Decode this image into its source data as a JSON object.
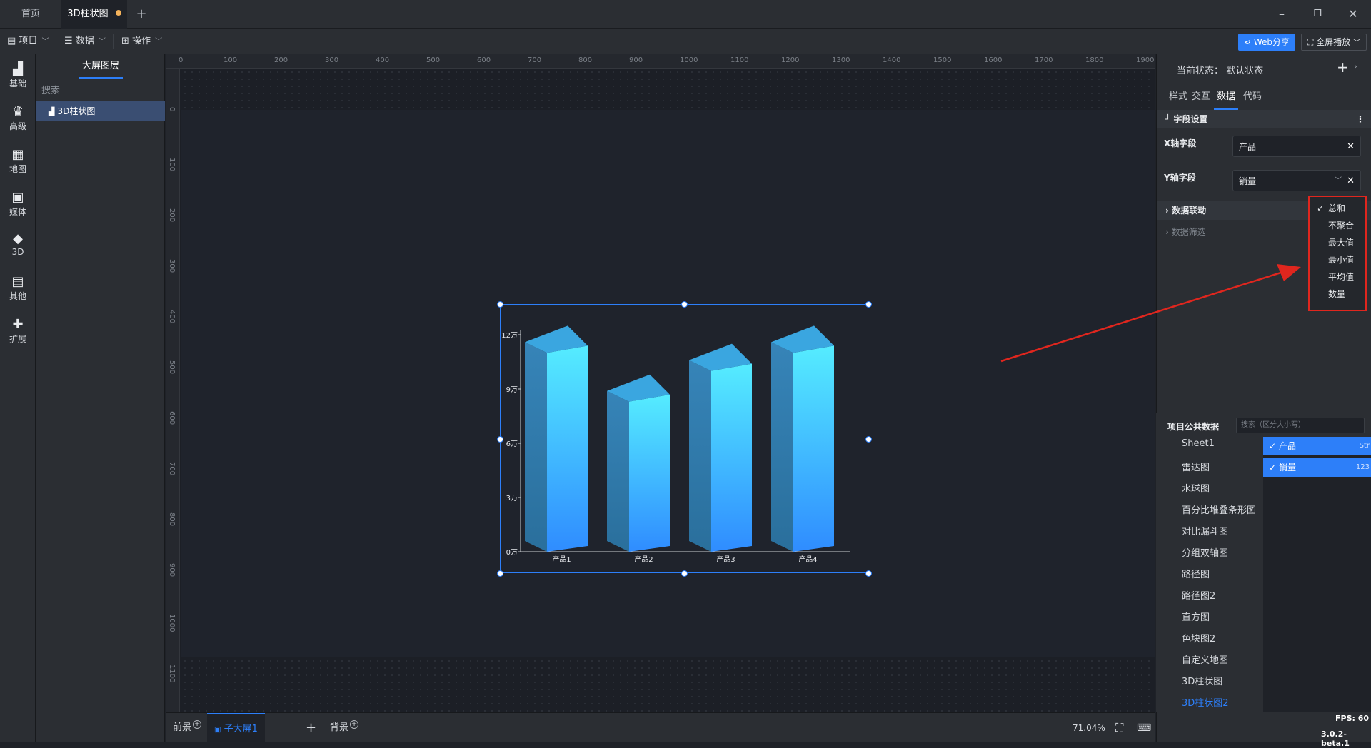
{
  "tabs": [
    {
      "label": "首页"
    },
    {
      "label": "3D柱状图"
    }
  ],
  "menu": {
    "project": "项目",
    "data": "数据",
    "operate": "操作",
    "web_share": "Web分享",
    "fullscreen": "全屏播放"
  },
  "rail": [
    {
      "label": "基础",
      "icon": "bar-chart-icon"
    },
    {
      "label": "高级",
      "icon": "crown-icon"
    },
    {
      "label": "地图",
      "icon": "map-icon"
    },
    {
      "label": "媒体",
      "icon": "media-icon"
    },
    {
      "label": "3D",
      "icon": "cube-icon"
    },
    {
      "label": "其他",
      "icon": "list-icon"
    },
    {
      "label": "扩展",
      "icon": "puzzle-icon"
    }
  ],
  "layers": {
    "tab": "大屏图层",
    "search_placeholder": "搜索",
    "items": [
      {
        "label": "3D柱状图"
      }
    ]
  },
  "rulers": {
    "top": [
      "0",
      "100",
      "200",
      "300",
      "400",
      "500",
      "600",
      "700",
      "800",
      "900",
      "1000",
      "1100",
      "1200",
      "1300",
      "1400",
      "1500",
      "1600",
      "1700",
      "1800",
      "1900"
    ],
    "left": [
      "0",
      "100",
      "200",
      "300",
      "400",
      "500",
      "600",
      "700",
      "800",
      "900",
      "1000",
      "1100"
    ]
  },
  "chart_data": {
    "type": "bar",
    "subtype": "3d-bar",
    "categories": [
      "产品1",
      "产品2",
      "产品3",
      "产品4"
    ],
    "values": [
      110000,
      83000,
      100000,
      110000
    ],
    "ylim": [
      0,
      120000
    ],
    "yticks": [
      "0万",
      "3万",
      "6万",
      "9万",
      "12万"
    ],
    "colors": {
      "top": "#3aa6e0",
      "front_top": "#55ecff",
      "front_bottom": "#2f8cff",
      "side": "#2f7bb0"
    }
  },
  "bottom": {
    "front": "前景",
    "sub_screen": "子大屏1",
    "background": "背景",
    "zoom": "71.04%"
  },
  "right_panel": {
    "state_label": "当前状态：",
    "state_value": "默认状态",
    "tabs": [
      "样式",
      "交互",
      "数据",
      "代码"
    ],
    "field_settings": "字段设置",
    "x_label": "X轴字段",
    "x_value": "产品",
    "y_label": "Y轴字段",
    "y_value": "销量",
    "linkage": "数据联动",
    "filter": "数据筛选",
    "agg_options": [
      "总和",
      "不聚合",
      "最大值",
      "最小值",
      "平均值",
      "数量"
    ],
    "public_data": "项目公共数据",
    "public_search": "搜索（区分大小写）",
    "sheets": [
      "Sheet1",
      "雷达图",
      "水球图",
      "百分比堆叠条形图",
      "对比漏斗图",
      "分组双轴图",
      "路径图",
      "路径图2",
      "直方图",
      "色块图2",
      "自定义地图",
      "3D柱状图",
      "3D柱状图2"
    ],
    "fields": [
      {
        "label": "产品",
        "type": "Str"
      },
      {
        "label": "销量",
        "type": "123"
      }
    ]
  },
  "status": {
    "fps": "FPS: 60",
    "version": "3.0.2-beta.1"
  },
  "annotation_color": "#e0261e"
}
